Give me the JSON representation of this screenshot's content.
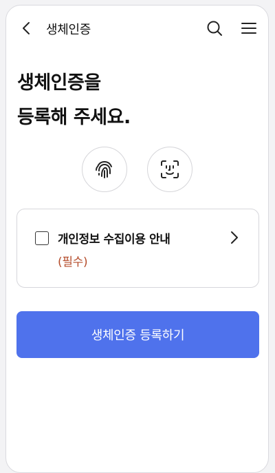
{
  "header": {
    "title": "생체인증",
    "back_icon": "chevron-left-icon",
    "search_icon": "search-icon",
    "menu_icon": "hamburger-menu-icon"
  },
  "headline": {
    "line1": "생체인증을",
    "line2": "등록해 주세요."
  },
  "biometric_options": [
    {
      "name": "fingerprint",
      "icon": "fingerprint-icon"
    },
    {
      "name": "face",
      "icon": "face-id-icon"
    }
  ],
  "consent": {
    "checked": false,
    "title": "개인정보 수집이용 안내",
    "required_label": "(필수)",
    "required_color": "#b44b2a"
  },
  "register_button": {
    "label": "생체인증 등록하기",
    "color": "#4f72ec"
  }
}
